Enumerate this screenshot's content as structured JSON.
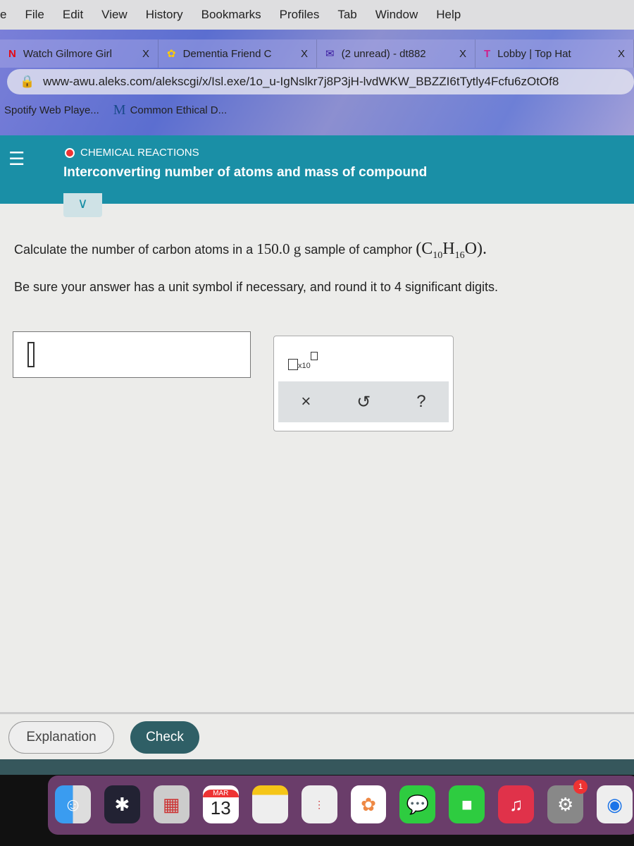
{
  "menubar": {
    "items": [
      "e",
      "File",
      "Edit",
      "View",
      "History",
      "Bookmarks",
      "Profiles",
      "Tab",
      "Window",
      "Help"
    ]
  },
  "tabs": [
    {
      "label": "Watch Gilmore Girl",
      "close": "X"
    },
    {
      "label": "Dementia Friend C",
      "close": "X"
    },
    {
      "label": "(2 unread) - dt882",
      "close": "X"
    },
    {
      "label": "Lobby | Top Hat",
      "close": "X"
    }
  ],
  "address": {
    "url": "www-awu.aleks.com/alekscgi/x/Isl.exe/1o_u-IgNslkr7j8P3jH-lvdWKW_BBZZI6tTytly4Fcfu6zOtOf8"
  },
  "bookmarks": [
    {
      "label": "Spotify Web Playe..."
    },
    {
      "icon_text": "M",
      "label": "Common Ethical D..."
    }
  ],
  "header": {
    "category": "CHEMICAL REACTIONS",
    "topic": "Interconverting number of atoms and mass of compound",
    "status_color": "#e33333"
  },
  "question": {
    "text": "Calculate the number of carbon atoms in a ",
    "mass": "150.0 g",
    "text2": " sample of camphor ",
    "formula": {
      "c": "C",
      "c_sub": "10",
      "h": "H",
      "h_sub": "16",
      "o": "O"
    },
    "instruction": "Be sure your answer has a unit symbol if necessary, and round it to 4 significant digits."
  },
  "answer": {
    "value": ""
  },
  "tools": {
    "x10_label": "x10",
    "clear": "×",
    "undo": "↺",
    "help": "?"
  },
  "actions": {
    "explanation": "Explanation",
    "check": "Check"
  },
  "dock": {
    "calendar_month": "MAR",
    "calendar_day": "13",
    "settings_badge": "1"
  },
  "colors": {
    "accent": "#1a8fa6",
    "check_button": "#2f5f66"
  }
}
